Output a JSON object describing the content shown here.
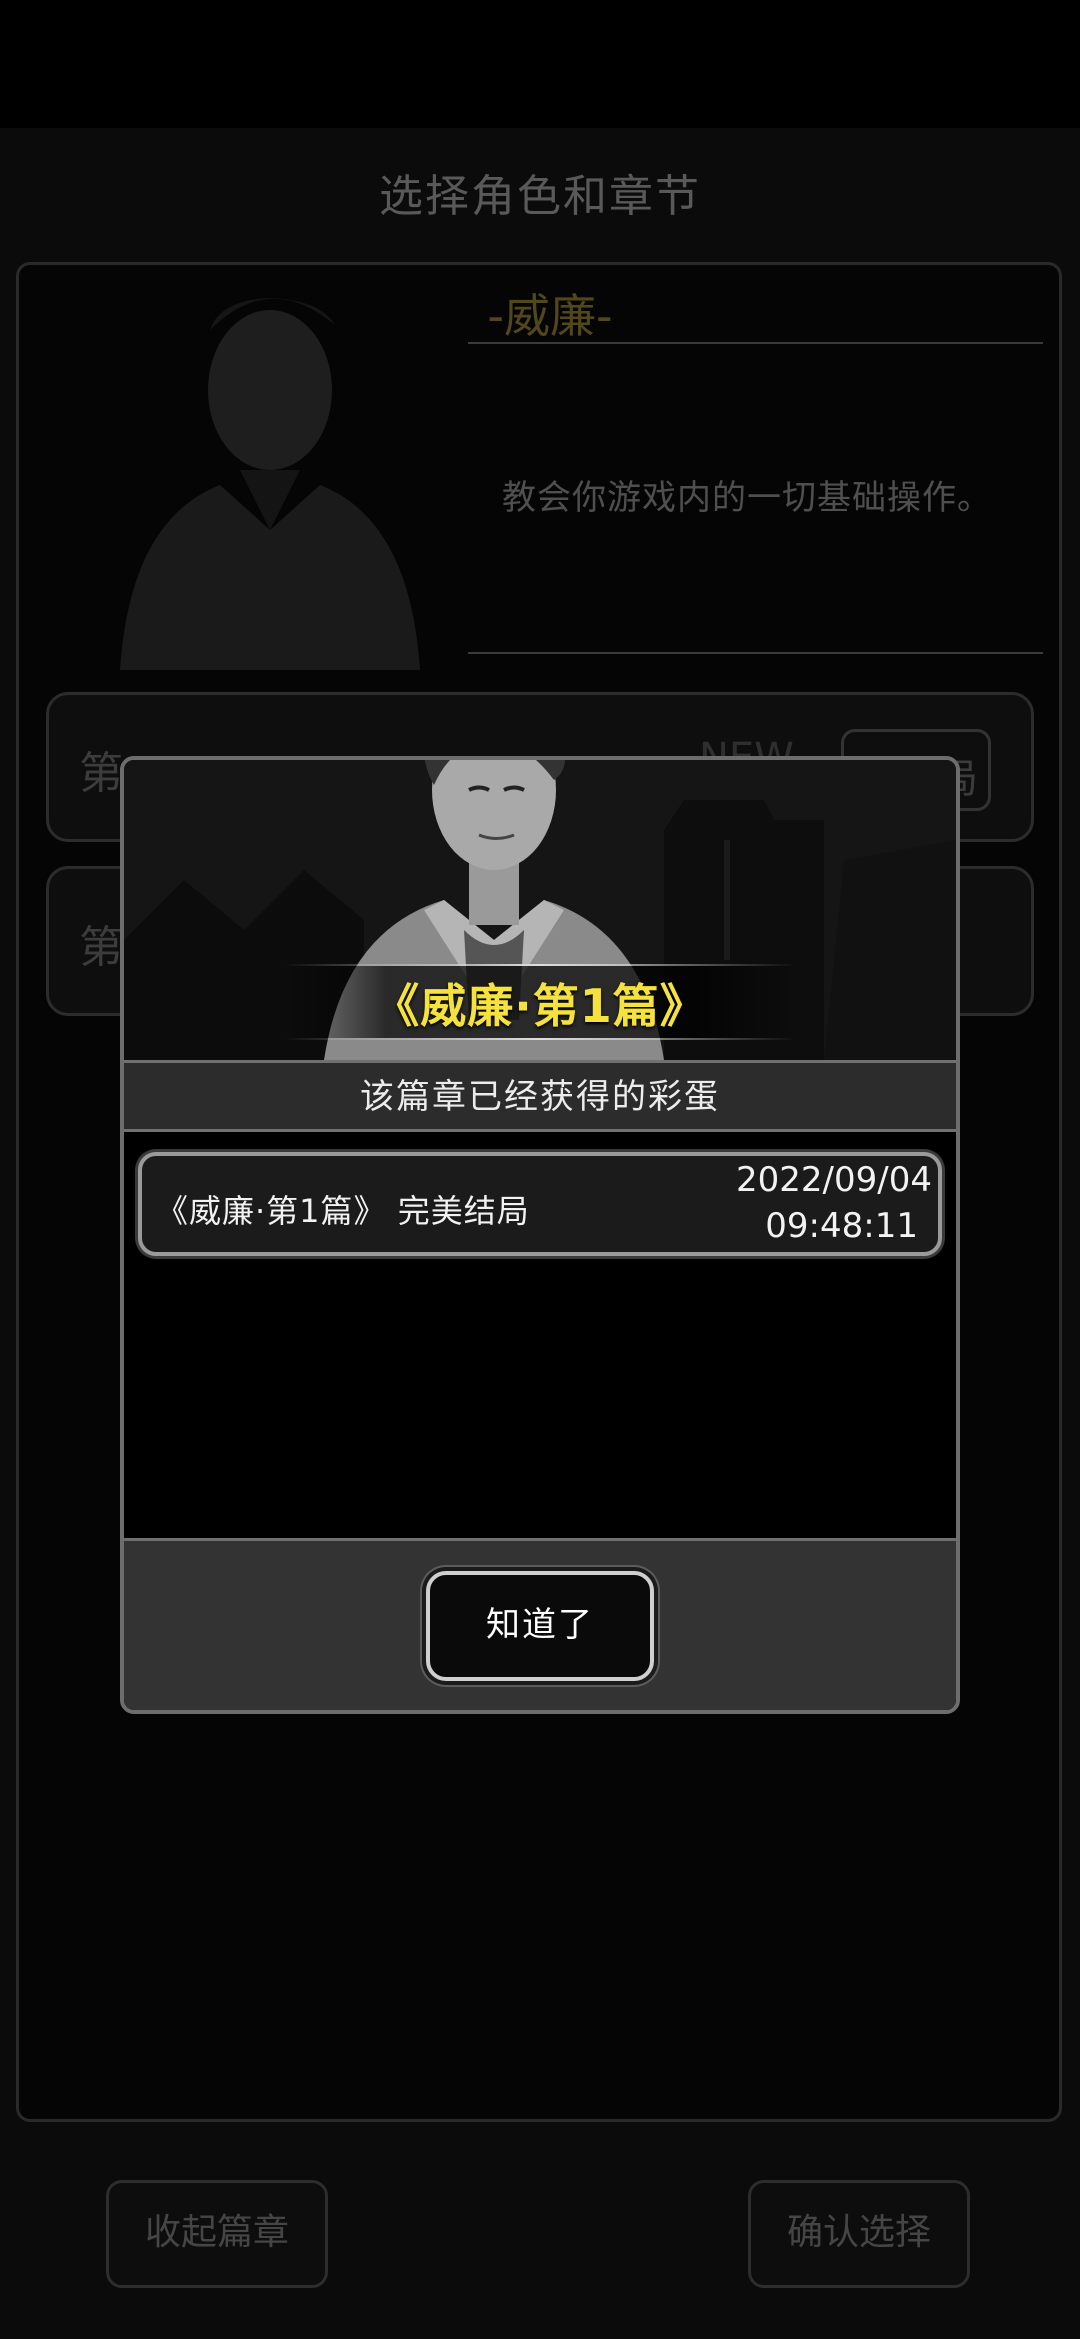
{
  "background_screen": {
    "title": "选择角色和章节",
    "character_name": "-威廉-",
    "description": "教会你游戏内的一切基础操作。",
    "chapter_1_label": "第",
    "chapter_1_new_badge": "NEW",
    "chapter_1_button": "局",
    "chapter_2_label": "第",
    "collapse_button": "收起篇章",
    "confirm_button": "确认选择"
  },
  "dialog": {
    "chapter_title": "《威廉·第1篇》",
    "subheader": "该篇章已经获得的彩蛋",
    "entries": [
      {
        "name": "《威廉·第1篇》  完美结局",
        "date": "2022/09/04",
        "time": "09:48:11"
      }
    ],
    "ok_button": "知道了"
  },
  "colors": {
    "title_yellow": "#f6e23c",
    "dim_text": "#4f4f4f",
    "dialog_border": "#6d6d6d"
  }
}
